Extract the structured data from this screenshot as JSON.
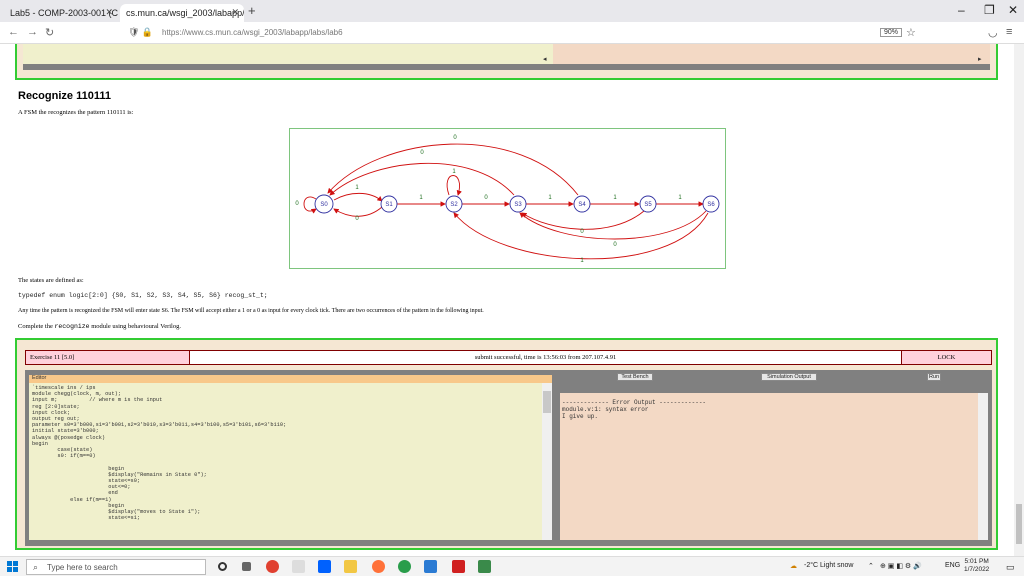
{
  "browser": {
    "tabs": [
      {
        "label": "Lab5 - COMP-2003-001 (Comp"
      },
      {
        "label": "cs.mun.ca/wsgi_2003/labapp/lab5"
      }
    ],
    "url": "https://www.cs.mun.ca/wsgi_2003/labapp/labs/lab6",
    "zoom": "90%"
  },
  "page": {
    "heading": "Recognize 110111",
    "intro": "A FSM the recognizes the pattern 110111 is:",
    "states_defined": "The states are defined as:",
    "typedef_code": "typedef enum logic[2:0] {S0, S1, S2, S3, S4, S5, S6} recog_st_t;",
    "pattern_note": "Any time the pattern is recognized the FSM will enter state S6. The FSM will accept either a 1 or a 0 as input for every clock tick. There are two occurrences of the pattern in the following input.",
    "complete_prefix": "Complete the ",
    "complete_code": "recognize",
    "complete_suffix": " module using behavioural Verilog."
  },
  "fsm": {
    "states": [
      "S0",
      "S1",
      "S2",
      "S3",
      "S4",
      "S5",
      "S6"
    ],
    "labels": {
      "s0_self": "0",
      "s0_s1": "1",
      "s1_s0": "0",
      "s1_s2": "1",
      "s2_self": "1",
      "s2_s3": "0",
      "s3_s4": "1",
      "s4_s5": "1",
      "s5_s6": "1",
      "s3_s0": "0",
      "s4_s0": "0",
      "s5_s3": "0",
      "s6_s3": "0",
      "s6_s2": "1"
    }
  },
  "exercise": {
    "title": "Exercise 11 [5.0]",
    "status": "submit successful, time is 13:56:03 from 207.107.4.91",
    "lock": "LOCK",
    "editor_label": "Editor",
    "test_bench": "Test Bench",
    "simulation_output": "Simulation Output",
    "run": "Run",
    "code": "`timescale 1ns / 1ps\nmodule chegg(clock, m, out);\ninput m;          // where m is the input\nreg [2:0]state;\ninput clock;\noutput reg out;\nparameter s0=3'b000,s1=3'b001,s2=3'b010,s3=3'b011,s4=3'b100,s5=3'b101,s6=3'b110;\ninitial state=3'b000;\nalways @(posedge clock)\nbegin\n        case(state)\n        s0: if(m==0)\n\n                        begin\n                        $display(\"Remains in State 0\");\n                        state<=s0;\n                        out<=0;\n                        end\n            else if(m==1)\n                        begin\n                        $display(\"moves to State 1\");\n                        state<=s1;",
    "output": "------------- Error Output -------------\nmodule.v:1: syntax error\nI give up."
  },
  "taskbar": {
    "search_placeholder": "Type here to search",
    "weather": "-2°C  Light snow",
    "lang": "ENG",
    "time": "5:01 PM",
    "date": "1/7/2022"
  }
}
